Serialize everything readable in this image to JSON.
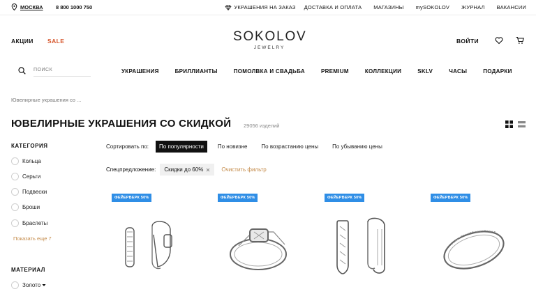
{
  "topbar": {
    "city": "МОСКВА",
    "phone": "8 800 1000 750",
    "links": [
      "УКРАШЕНИЯ НА ЗАКАЗ",
      "ДОСТАВКА И ОПЛАТА",
      "МАГАЗИНЫ",
      "mySOKOLOV",
      "ЖУРНАЛ",
      "ВАКАНСИИ"
    ]
  },
  "header": {
    "promo": "АКЦИИ",
    "sale": "SALE",
    "logo_main": "SOKOLOV",
    "logo_sub": "JEWELRY",
    "login": "ВОЙТИ"
  },
  "search": {
    "placeholder": "ПОИСК"
  },
  "nav": [
    "УКРАШЕНИЯ",
    "БРИЛЛИАНТЫ",
    "ПОМОЛВКА И СВАДЬБА",
    "PREMIUM",
    "КОЛЛЕКЦИИ",
    "SKLV",
    "ЧАСЫ",
    "ПОДАРКИ"
  ],
  "breadcrumb": "Ювелирные украшения со ...",
  "page": {
    "title": "ЮВЕЛИРНЫЕ УКРАШЕНИЯ СО СКИДКОЙ",
    "count": "29056 изделий"
  },
  "sidebar": {
    "category_title": "КАТЕГОРИЯ",
    "categories": [
      "Кольца",
      "Серьги",
      "Подвески",
      "Броши",
      "Браслеты"
    ],
    "show_more": "Показать еще 7",
    "material_title": "МАТЕРИАЛ",
    "materials": [
      "Золото"
    ]
  },
  "sort": {
    "label": "Сортировать по:",
    "options": [
      "По популярности",
      "По новизне",
      "По возрастанию цены",
      "По убыванию цены"
    ]
  },
  "special": {
    "label": "Спецпредложение:",
    "chip": "Скидки до 60%",
    "clear": "Очистить фильтр"
  },
  "products": [
    {
      "badge": "ФЕЙЕРВЕРК 50%",
      "kind": "earrings-drop"
    },
    {
      "badge": "ФЕЙЕРВЕРК 50%",
      "kind": "ring-solitaire"
    },
    {
      "badge": "ФЕЙЕРВЕРК 50%",
      "kind": "earrings-long"
    },
    {
      "badge": "ФЕЙЕРВЕРК 50%",
      "kind": "ring-band"
    }
  ],
  "colors": {
    "accent": "#d6552b",
    "gold": "#c48b4a",
    "badge": "#2f8ee6"
  }
}
